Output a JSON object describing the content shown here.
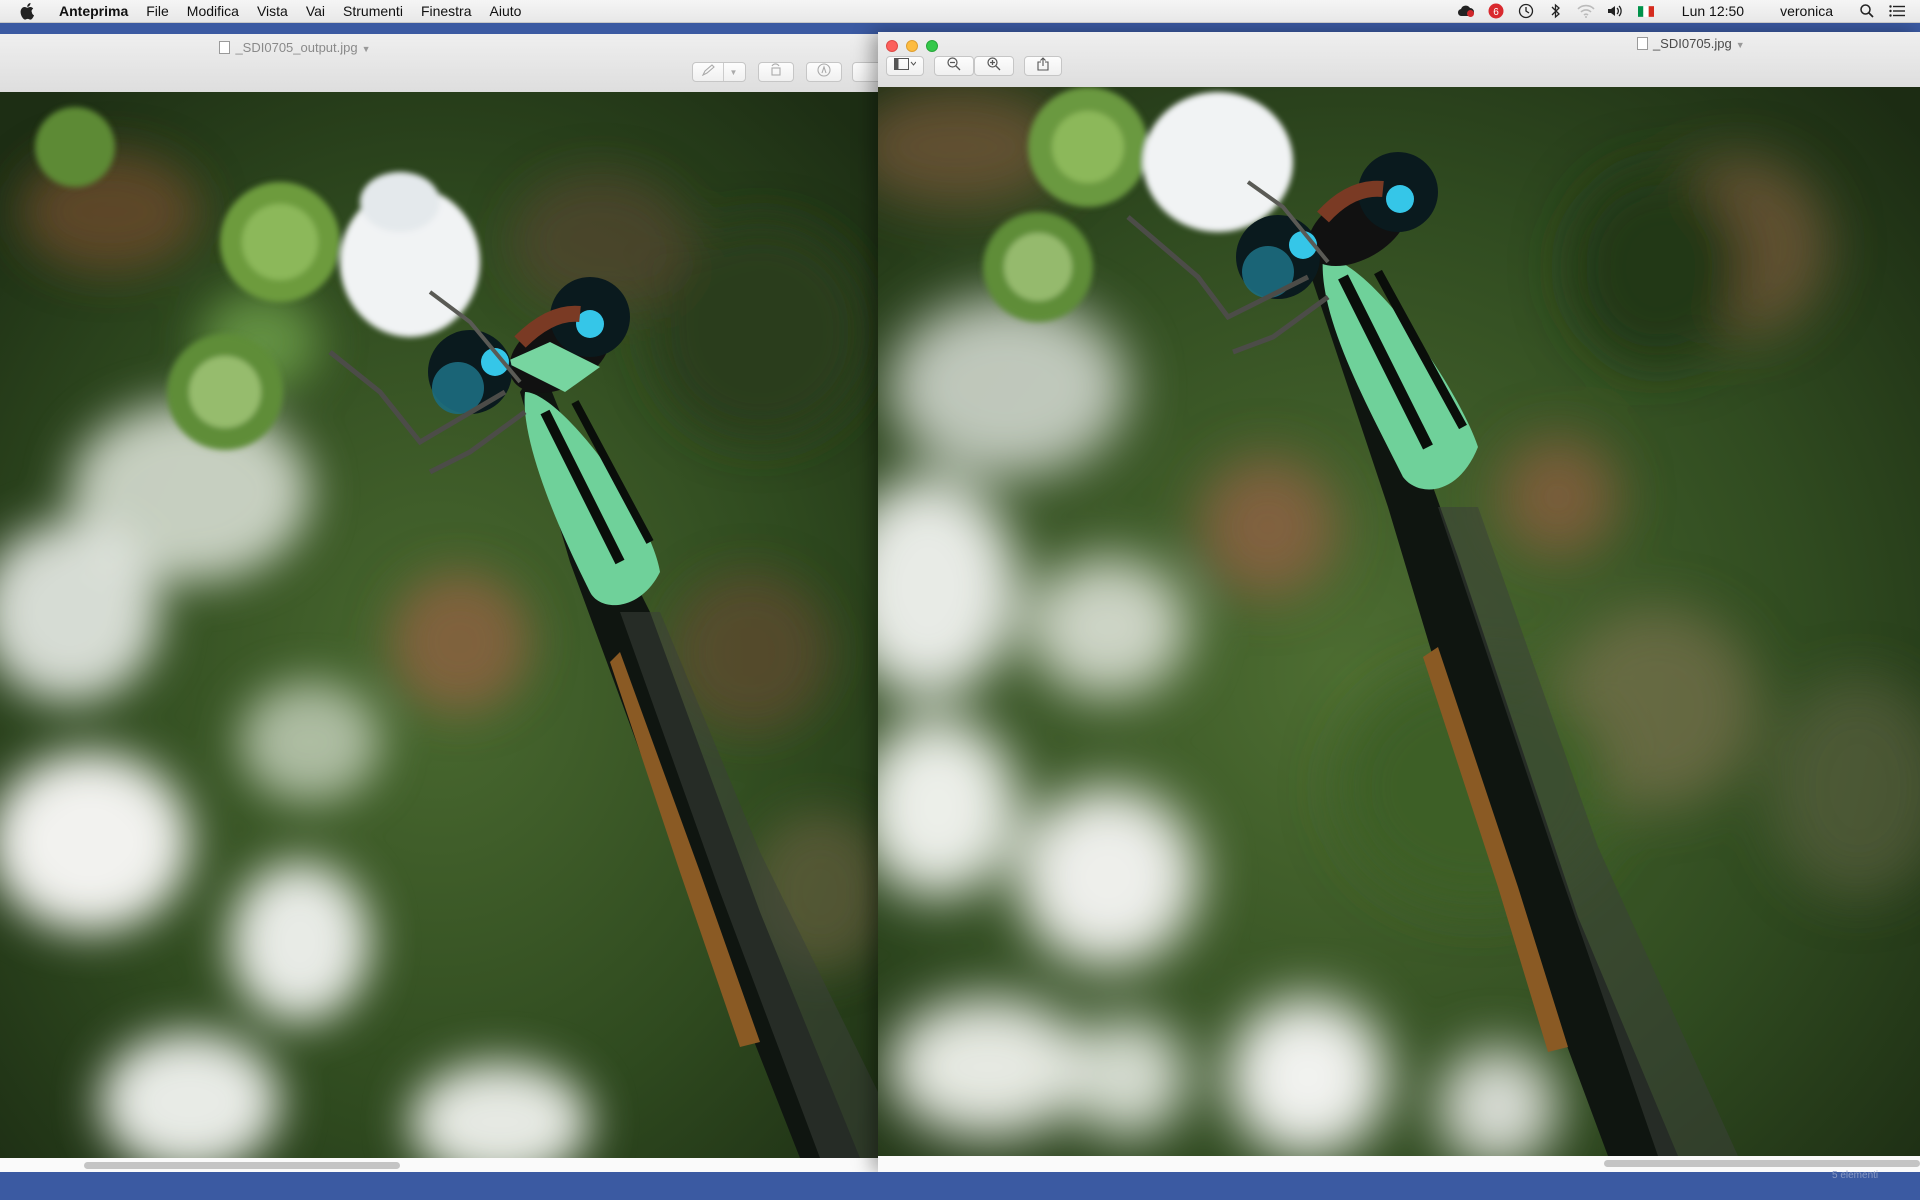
{
  "menubar": {
    "app_name": "Anteprima",
    "menus": [
      "File",
      "Modifica",
      "Vista",
      "Vai",
      "Strumenti",
      "Finestra",
      "Aiuto"
    ],
    "status_icons": [
      "creative-cloud-icon",
      "notification-badge-icon",
      "time-machine-icon",
      "bluetooth-icon",
      "wifi-icon",
      "volume-icon",
      "flag-italy-icon"
    ],
    "clock": "Lun 12:50",
    "user": "veronica",
    "spotlight_icon": "search-icon",
    "notification_icon": "list-icon"
  },
  "back_window": {
    "title": "_SDI0705_output.jpg",
    "toolbar_icons": [
      "pen-icon",
      "chevron-down-icon",
      "rotate-icon",
      "markup-icon"
    ]
  },
  "front_window": {
    "title": "_SDI0705.jpg",
    "toolbar_icons": [
      "sidebar-icon",
      "zoom-out-icon",
      "zoom-in-icon",
      "share-icon"
    ]
  },
  "finder_status": "5 elementi",
  "colors": {
    "desktop": "#2c4a8c",
    "damselfly_green": "#6fd19a",
    "eye_cyan": "#35c6e8",
    "background_green": "#3f5c2a"
  }
}
